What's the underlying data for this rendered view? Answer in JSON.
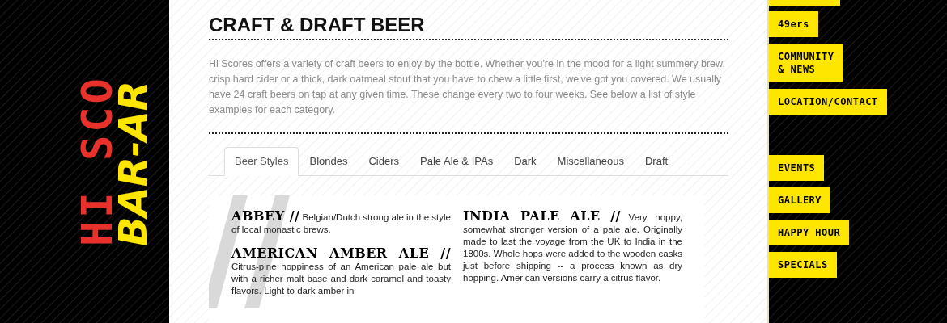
{
  "logo": {
    "line_1": "HI SCO",
    "line_2": "BAR-AR"
  },
  "page": {
    "title": "CRAFT & DRAFT BEER",
    "intro": "Hi Scores offers a variety of craft beers to enjoy by the bottle. Whether you're in the mood for a light summery brew, crisp hard cider or a thick, dark oatmeal stout that you have to chew a little first, we've got you covered. We usually have 24 craft beers on tap at any given time. These change every two to four weeks. See below a list of style examples for each category."
  },
  "tabs": [
    {
      "label": "Beer Styles",
      "selected": true
    },
    {
      "label": "Blondes",
      "selected": false
    },
    {
      "label": "Ciders",
      "selected": false
    },
    {
      "label": "Pale Ale & IPAs",
      "selected": false
    },
    {
      "label": "Dark",
      "selected": false
    },
    {
      "label": "Miscellaneous",
      "selected": false
    },
    {
      "label": "Draft",
      "selected": false
    }
  ],
  "styles_columns": [
    {
      "entries": [
        {
          "name": "ABBEY //",
          "description": "Belgian/Dutch strong ale in the style of local monastic brews."
        },
        {
          "name": "AMERICAN AMBER ALE //",
          "description": "Citrus-pine hoppiness of an American pale ale but with a richer malt base and dark caramel and toasty flavors. Light to dark amber in"
        }
      ]
    },
    {
      "entries": [
        {
          "name": "INDIA PALE ALE //",
          "description": "Very hoppy, somewhat stronger version of a pale ale. Originally made to last the voyage from the UK to India in the 1800s. Whole hops were added to the wooden casks just before shipping -- a process known as dry hopping. American versions carry a citrus flavor."
        }
      ]
    }
  ],
  "nav_groups": [
    {
      "items": [
        "49ers",
        "COMMUNITY\n& NEWS",
        "LOCATION/CONTACT"
      ]
    },
    {
      "items": [
        "EVENTS",
        "GALLERY",
        "HAPPY HOUR",
        "SPECIALS"
      ]
    }
  ]
}
